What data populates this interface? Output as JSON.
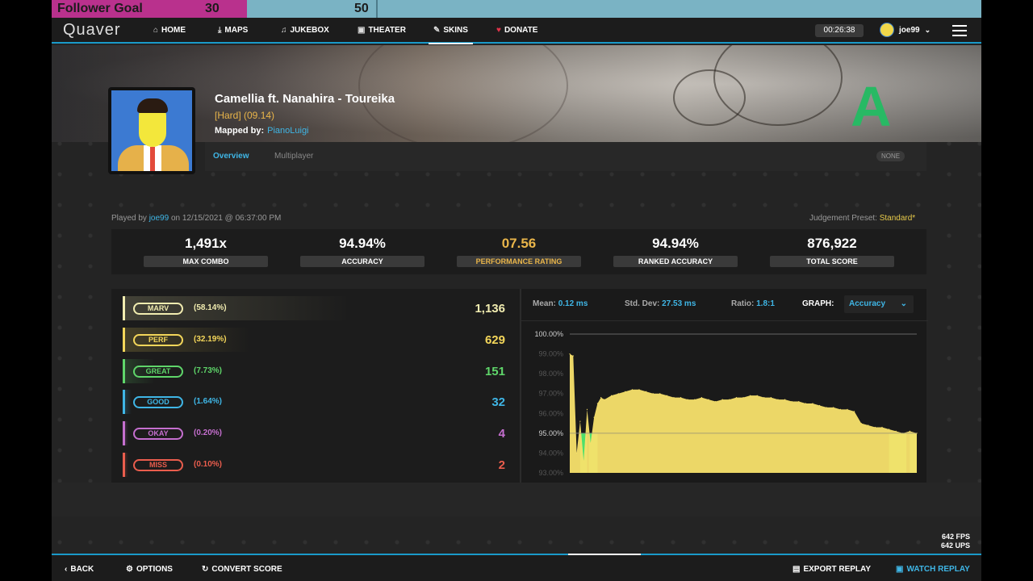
{
  "follower_goal": {
    "label": "Follower Goal",
    "current": "30",
    "target": "50",
    "progress": 0.6
  },
  "nav": {
    "logo": "Quaver",
    "items": [
      {
        "label": "HOME",
        "icon": "home-icon"
      },
      {
        "label": "MAPS",
        "icon": "download-icon"
      },
      {
        "label": "JUKEBOX",
        "icon": "music-icon"
      },
      {
        "label": "THEATER",
        "icon": "camera-icon"
      },
      {
        "label": "SKINS",
        "icon": "brush-icon"
      },
      {
        "label": "DONATE",
        "icon": "heart-icon"
      }
    ],
    "timer": "00:26:38",
    "username": "joe99"
  },
  "song": {
    "title": "Camellia ft. Nanahira - Toureika",
    "difficulty": "[Hard] (09.14)",
    "mapped_by_label": "Mapped by:",
    "mapper": "PianoLuigi",
    "grade": "A"
  },
  "tabs": {
    "overview": "Overview",
    "multiplayer": "Multiplayer",
    "modifier_badge": "NONE"
  },
  "play_info": {
    "played_by_label": "Played by",
    "player": "joe99",
    "date_text": "on 12/15/2021 @ 06:37:00 PM",
    "preset_label": "Judgement Preset:",
    "preset": "Standard*"
  },
  "stats": [
    {
      "value": "1,491x",
      "label": "MAX COMBO",
      "color": "#ffffff"
    },
    {
      "value": "94.94%",
      "label": "ACCURACY",
      "color": "#ffffff"
    },
    {
      "value": "07.56",
      "label": "PERFORMANCE RATING",
      "color": "#e9b54a"
    },
    {
      "value": "94.94%",
      "label": "RANKED ACCURACY",
      "color": "#ffffff"
    },
    {
      "value": "876,922",
      "label": "TOTAL SCORE",
      "color": "#ffffff"
    }
  ],
  "judgements": [
    {
      "name": "MARV",
      "percent": "(58.14%)",
      "count": "1,136",
      "color": "#f1ecb0",
      "fraction": 0.5814
    },
    {
      "name": "PERF",
      "percent": "(32.19%)",
      "count": "629",
      "color": "#f3d65a",
      "fraction": 0.3219
    },
    {
      "name": "GREAT",
      "percent": "(7.73%)",
      "count": "151",
      "color": "#5fd66a",
      "fraction": 0.0773
    },
    {
      "name": "GOOD",
      "percent": "(1.64%)",
      "count": "32",
      "color": "#3fb6e6",
      "fraction": 0.0164
    },
    {
      "name": "OKAY",
      "percent": "(0.20%)",
      "count": "4",
      "color": "#c56fcf",
      "fraction": 0.002
    },
    {
      "name": "MISS",
      "percent": "(0.10%)",
      "count": "2",
      "color": "#ea5d4d",
      "fraction": 0.001
    }
  ],
  "graph": {
    "mean_label": "Mean:",
    "mean": "0.12 ms",
    "std_label": "Std. Dev:",
    "std": "27.53 ms",
    "ratio_label": "Ratio:",
    "ratio": "1.8:1",
    "graph_label": "GRAPH:",
    "graph_type": "Accuracy"
  },
  "chart_data": {
    "type": "area",
    "ylim": [
      93,
      100
    ],
    "yticks": [
      "100.00%",
      "99.00%",
      "98.00%",
      "97.00%",
      "96.00%",
      "95.00%",
      "94.00%",
      "93.00%"
    ],
    "x": [
      0,
      1,
      2,
      3,
      4,
      5,
      6,
      7,
      8,
      9,
      10,
      12,
      14,
      16,
      18,
      20,
      22,
      24,
      26,
      28,
      30,
      32,
      34,
      36,
      38,
      40,
      42,
      44,
      46,
      48,
      50,
      52,
      54,
      56,
      58,
      60,
      62,
      64,
      66,
      68,
      70,
      72,
      74,
      76,
      78,
      80,
      82,
      84,
      86,
      88,
      90,
      92,
      94,
      96,
      98,
      100
    ],
    "values": [
      99.0,
      98.9,
      94.0,
      95.6,
      93.6,
      96.2,
      94.5,
      95.8,
      96.5,
      96.8,
      96.7,
      96.9,
      97.0,
      97.1,
      97.2,
      97.2,
      97.1,
      97.0,
      97.0,
      96.9,
      96.8,
      96.8,
      96.7,
      96.7,
      96.8,
      96.7,
      96.6,
      96.7,
      96.7,
      96.8,
      96.8,
      96.9,
      96.9,
      96.8,
      96.8,
      96.7,
      96.7,
      96.6,
      96.6,
      96.5,
      96.5,
      96.4,
      96.3,
      96.3,
      96.2,
      96.2,
      96.1,
      95.5,
      95.4,
      95.3,
      95.3,
      95.2,
      95.1,
      95.0,
      95.1,
      95.0
    ],
    "colors": {
      "fill": "#f8e16b",
      "low": "#4ee06b",
      "guide": "#666666"
    }
  },
  "fps": {
    "fps": "642 FPS",
    "ups": "642 UPS"
  },
  "footer": {
    "back": "BACK",
    "options": "OPTIONS",
    "convert": "CONVERT SCORE",
    "export": "EXPORT REPLAY",
    "watch": "WATCH REPLAY"
  }
}
